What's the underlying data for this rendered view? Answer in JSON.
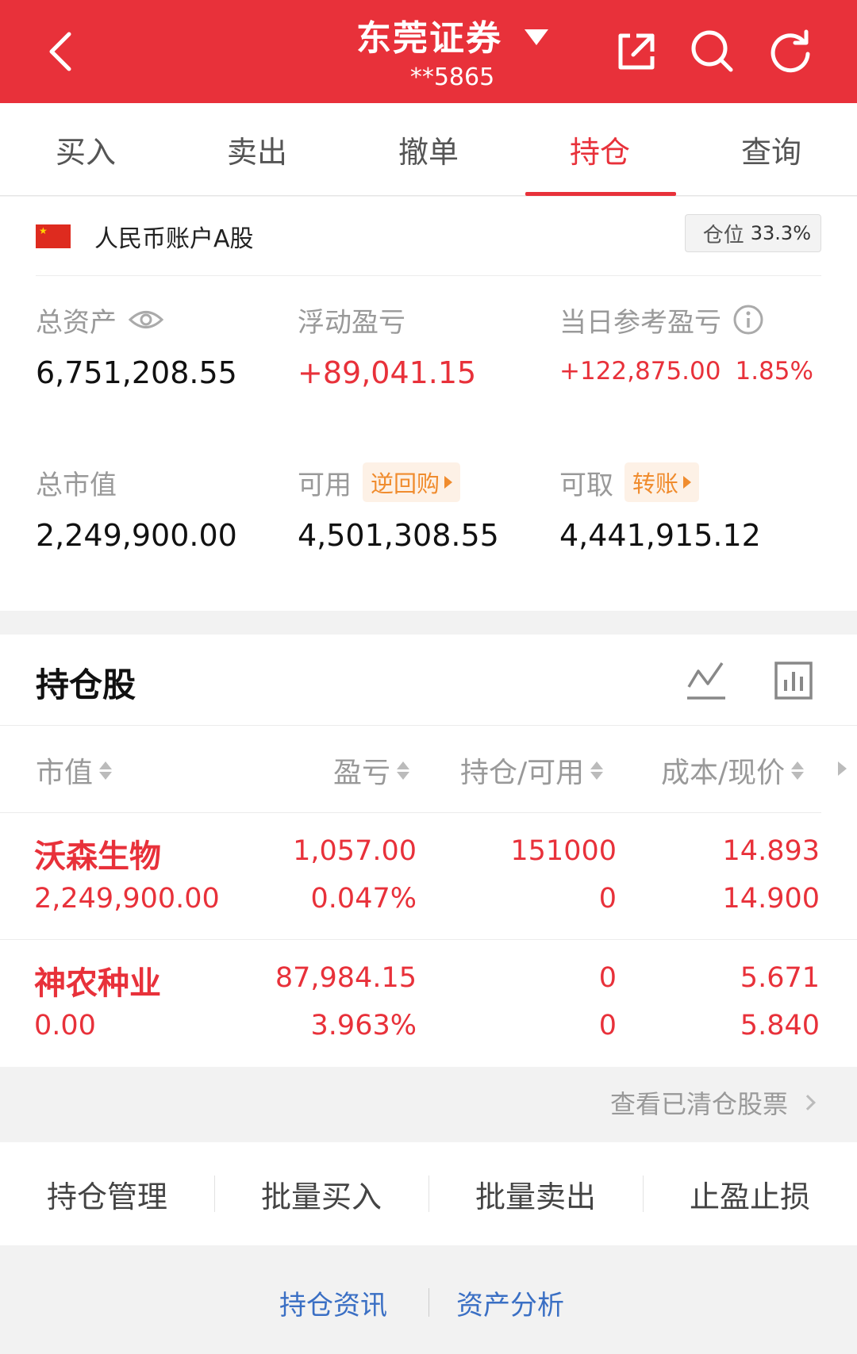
{
  "header": {
    "title": "东莞证券",
    "account_masked": "**5865"
  },
  "tabs": [
    {
      "label": "买入",
      "active": false
    },
    {
      "label": "卖出",
      "active": false
    },
    {
      "label": "撤单",
      "active": false
    },
    {
      "label": "持仓",
      "active": true
    },
    {
      "label": "查询",
      "active": false
    }
  ],
  "account": {
    "label": "人民币账户A股",
    "position_label": "仓位",
    "position_value": "33.3%"
  },
  "metrics": {
    "total_assets": {
      "label": "总资产",
      "value": "6,751,208.55"
    },
    "floating_pnl": {
      "label": "浮动盈亏",
      "value": "+89,041.15"
    },
    "daily_pnl": {
      "label": "当日参考盈亏",
      "value": "+122,875.00",
      "pct": "1.85%"
    },
    "market_value": {
      "label": "总市值",
      "value": "2,249,900.00"
    },
    "available": {
      "label": "可用",
      "pill": "逆回购",
      "value": "4,501,308.55"
    },
    "withdrawable": {
      "label": "可取",
      "pill": "转账",
      "value": "4,441,915.12"
    }
  },
  "holdings": {
    "title": "持仓股",
    "columns": [
      "市值",
      "盈亏",
      "持仓/可用",
      "成本/现价"
    ],
    "rows": [
      {
        "name": "沃森生物",
        "market_value": "2,249,900.00",
        "pnl": "1,057.00",
        "pnl_pct": "0.047%",
        "position": "151000",
        "available": "0",
        "cost": "14.893",
        "price": "14.900"
      },
      {
        "name": "神农种业",
        "market_value": "0.00",
        "pnl": "87,984.15",
        "pnl_pct": "3.963%",
        "position": "0",
        "available": "0",
        "cost": "5.671",
        "price": "5.840"
      }
    ],
    "cleared_link": "查看已清仓股票"
  },
  "actions": [
    "持仓管理",
    "批量买入",
    "批量卖出",
    "止盈止损"
  ],
  "bottom_links": [
    "持仓资讯",
    "资产分析"
  ],
  "colors": {
    "brand_red": "#e8313a",
    "accent_orange": "#f08c2e",
    "link_blue": "#3a6fc4"
  }
}
